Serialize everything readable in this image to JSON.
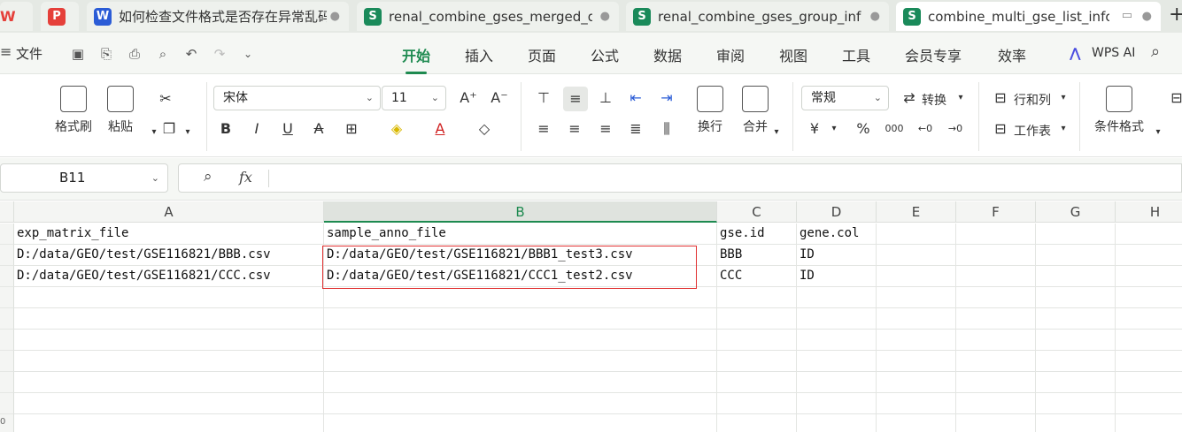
{
  "tabs": [
    {
      "label": "WPS",
      "badge": "",
      "kind": "logo"
    },
    {
      "label": "如何检查文件格式是否存在异常乱码",
      "badge": "W",
      "kind": "w"
    },
    {
      "label": "renal_combine_gses_merged_data",
      "badge": "S",
      "kind": "s"
    },
    {
      "label": "renal_combine_gses_group_info",
      "badge": "S",
      "kind": "s"
    },
    {
      "label": "combine_multi_gse_list_info",
      "badge": "S",
      "kind": "s",
      "active": true
    }
  ],
  "menubar": {
    "file_label": "文件",
    "items": [
      "开始",
      "插入",
      "页面",
      "公式",
      "数据",
      "审阅",
      "视图",
      "工具",
      "会员专享",
      "效率"
    ],
    "active_item": "开始",
    "wps_ai_label": "WPS AI"
  },
  "ribbon": {
    "format_painter_label": "格式刷",
    "paste_label": "粘贴",
    "font_name": "宋体",
    "font_size": "11",
    "wrap_label": "换行",
    "merge_label": "合并",
    "number_format": "常规",
    "convert_label": "转换",
    "rows_cols_label": "行和列",
    "worksheet_label": "工作表",
    "cond_format_label": "条件格式",
    "currency_symbol": "¥",
    "percent_symbol": "%",
    "thousands_symbol": "000"
  },
  "formula_bar": {
    "name_box": "B11",
    "fx_label": "fx",
    "formula": ""
  },
  "sheet": {
    "columns": [
      "A",
      "B",
      "C",
      "D",
      "E",
      "F",
      "G",
      "H"
    ],
    "selected_column": "B",
    "rows": [
      [
        "exp_matrix_file",
        "sample_anno_file",
        "gse.id",
        "gene.col"
      ],
      [
        "D:/data/GEO/test/GSE116821/BBB.csv",
        "D:/data/GEO/test/GSE116821/BBB1_test3.csv",
        "BBB",
        "ID"
      ],
      [
        "D:/data/GEO/test/GSE116821/CCC.csv",
        "D:/data/GEO/test/GSE116821/CCC1_test2.csv",
        "CCC",
        "ID"
      ]
    ],
    "last_row_number": "0"
  }
}
